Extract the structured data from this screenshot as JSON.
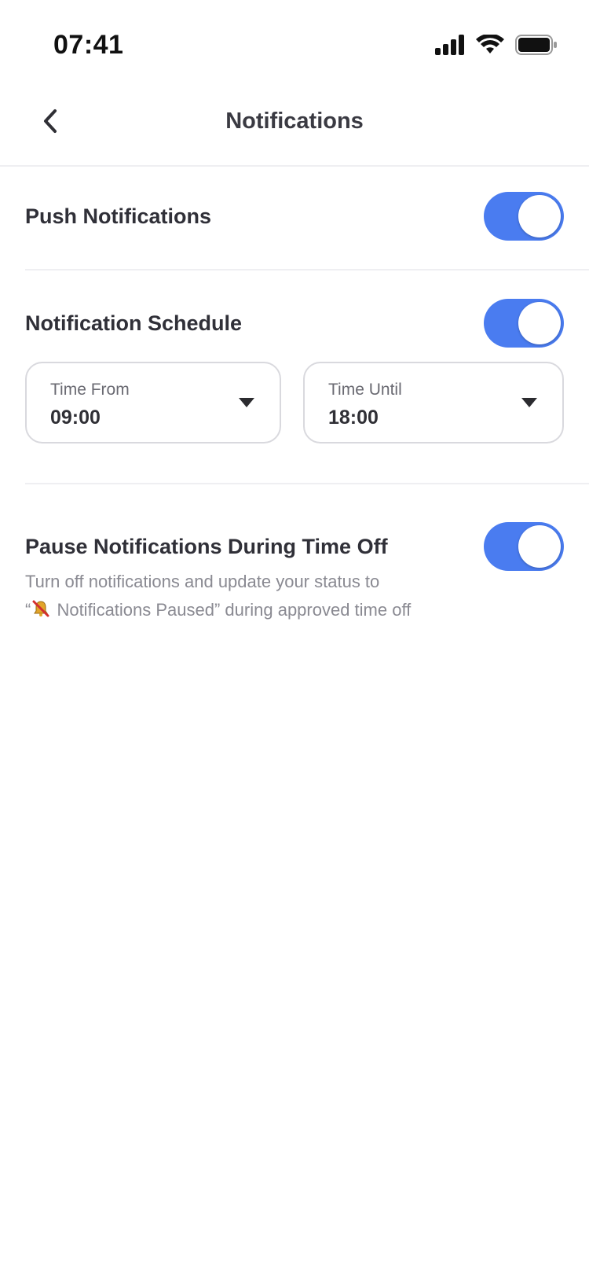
{
  "status_bar": {
    "time": "07:41"
  },
  "header": {
    "title": "Notifications",
    "back_icon": "chevron-left-icon"
  },
  "settings": {
    "push": {
      "label": "Push Notifications",
      "enabled": true
    },
    "schedule": {
      "label": "Notification Schedule",
      "enabled": true,
      "time_from": {
        "label": "Time From",
        "value": "09:00"
      },
      "time_until": {
        "label": "Time Until",
        "value": "18:00"
      }
    },
    "pause_time_off": {
      "label": "Pause Notifications During Time Off",
      "enabled": true,
      "description_line1": "Turn off notifications and update your status to",
      "description_open_quote": "“",
      "description_line2": " Notifications Paused” during approved time off",
      "status_icon": "muted-bell-icon"
    }
  },
  "colors": {
    "accent": "#4a7cf0",
    "text_primary": "#303038",
    "text_secondary": "#8a8a92",
    "divider": "#efeff2"
  }
}
